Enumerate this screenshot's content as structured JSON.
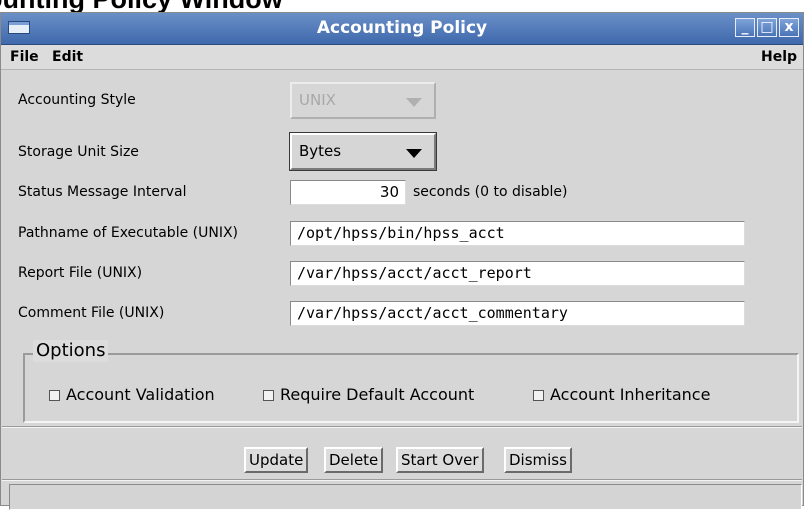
{
  "doc_heading": "ounting Policy Window",
  "window": {
    "title": "Accounting Policy",
    "controls": {
      "minimize": "_",
      "maximize": "□",
      "close": "x"
    }
  },
  "menu": {
    "file": "File",
    "edit": "Edit",
    "help": "Help"
  },
  "form": {
    "accounting_style": {
      "label": "Accounting Style",
      "value": "UNIX"
    },
    "storage_unit_size": {
      "label": "Storage Unit Size",
      "value": "Bytes"
    },
    "status_message_interval": {
      "label": "Status Message Interval",
      "value": "30",
      "suffix": "seconds (0 to disable)"
    },
    "pathname_executable": {
      "label": "Pathname of Executable (UNIX)",
      "value": "/opt/hpss/bin/hpss_acct"
    },
    "report_file": {
      "label": "Report File (UNIX)",
      "value": "/var/hpss/acct/acct_report"
    },
    "comment_file": {
      "label": "Comment File (UNIX)",
      "value": "/var/hpss/acct/acct_commentary"
    }
  },
  "options": {
    "legend": "Options",
    "account_validation": "Account Validation",
    "require_default_account": "Require Default Account",
    "account_inheritance": "Account Inheritance"
  },
  "buttons": {
    "update": "Update",
    "delete": "Delete",
    "start_over": "Start Over",
    "dismiss": "Dismiss"
  },
  "colors": {
    "titlebar": "#4f78b8",
    "window_bg": "#dcdcdc"
  }
}
